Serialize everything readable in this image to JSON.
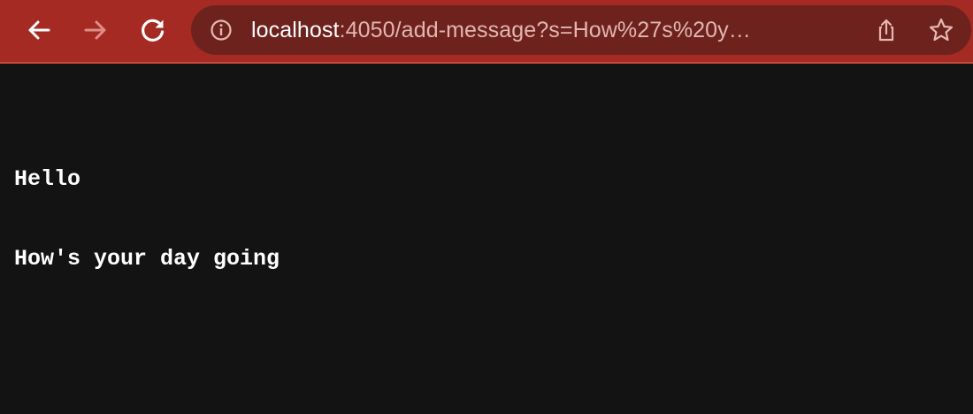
{
  "browser": {
    "url_host": "localhost",
    "url_rest": ":4050/add-message?s=How%27s%20y…",
    "icons": {
      "back": "arrow-left-icon",
      "forward": "arrow-right-icon",
      "reload": "reload-icon",
      "site_info": "info-icon",
      "share": "share-icon",
      "bookmark": "star-icon"
    },
    "colors": {
      "toolbar": "#a52a23",
      "omnibox": "#6e221d",
      "page_background": "#131313"
    }
  },
  "page": {
    "messages": [
      "Hello",
      "How's your day going"
    ]
  }
}
